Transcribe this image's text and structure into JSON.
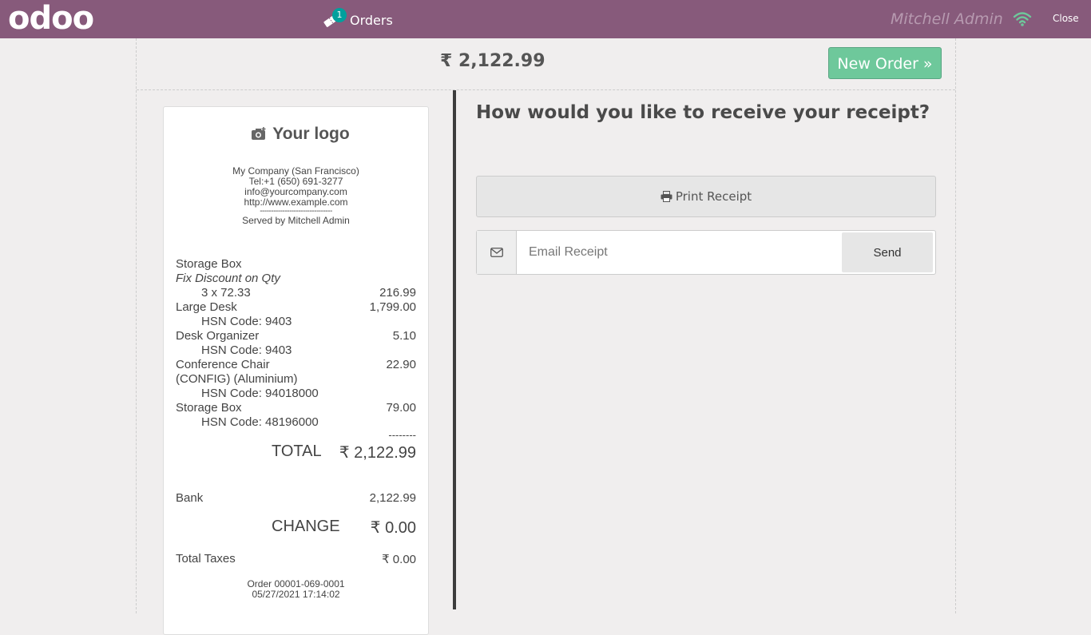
{
  "topbar": {
    "brand": "odoo",
    "orders_label": "Orders",
    "orders_count": "1",
    "user": "Mitchell Admin",
    "close_label": "Close",
    "colors": {
      "bar": "#875a7b",
      "badge": "#00a09d",
      "wifi": "#6ec89b"
    }
  },
  "header": {
    "total": "₹ 2,122.99",
    "new_order_label": "New Order »"
  },
  "receipt": {
    "logo_text": "Your logo",
    "company": [
      "My Company (San Francisco)",
      "Tel:+1 (650) 691-3277",
      "info@yourcompany.com",
      "http://www.example.com",
      "--------------------------------",
      "Served by Mitchell Admin"
    ],
    "lines": [
      {
        "name": "Storage Box",
        "amount": ""
      },
      {
        "name": "Fix Discount on Qty",
        "amount": "",
        "italic": true
      },
      {
        "name": "3 x 72.33",
        "amount": "216.99",
        "indent": true
      },
      {
        "name": "Large Desk",
        "amount": "1,799.00"
      },
      {
        "name": "HSN Code: 9403",
        "amount": "",
        "indent": true
      },
      {
        "name": "Desk Organizer",
        "amount": "5.10"
      },
      {
        "name": "HSN Code: 9403",
        "amount": "",
        "indent": true
      },
      {
        "name": "Conference Chair",
        "amount": "22.90"
      },
      {
        "name": "(CONFIG) (Aluminium)",
        "amount": ""
      },
      {
        "name": "HSN Code: 94018000",
        "amount": "",
        "indent": true
      },
      {
        "name": "Storage Box",
        "amount": "79.00"
      },
      {
        "name": "HSN Code: 48196000",
        "amount": "",
        "indent": true
      }
    ],
    "separator": "--------",
    "total_label": "TOTAL",
    "total_value": "₹ 2,122.99",
    "payment_label": "Bank",
    "payment_value": "2,122.99",
    "change_label": "CHANGE",
    "change_value": "₹ 0.00",
    "taxes_label": "Total Taxes",
    "taxes_value": "₹ 0.00",
    "order_ref": "Order 00001-069-0001",
    "order_date": "05/27/2021 17:14:02"
  },
  "receipt_options": {
    "title": "How would you like to receive your receipt?",
    "print_label": "Print Receipt",
    "email_placeholder": "Email Receipt",
    "send_label": "Send"
  }
}
